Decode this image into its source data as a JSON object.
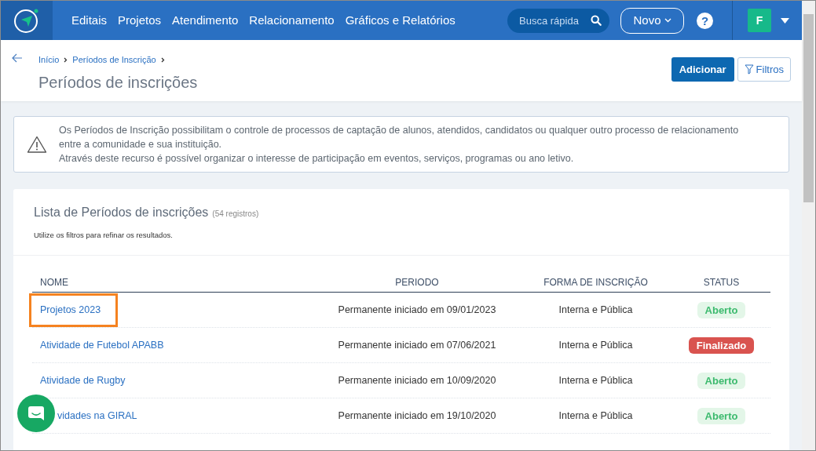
{
  "nav": {
    "items": [
      "Editais",
      "Projetos",
      "Atendimento",
      "Relacionamento",
      "Gráficos e Relatórios"
    ],
    "search": {
      "placeholder": "Busca rápida"
    },
    "new_button": "Novo",
    "help": "?",
    "avatar": "F"
  },
  "breadcrumb": [
    "Início",
    "Períodos de Inscrição"
  ],
  "page_title": "Períodos de inscrições",
  "actions": {
    "add": "Adicionar",
    "filters": "Filtros"
  },
  "alert": {
    "lines": [
      "Os Períodos de Inscrição possibilitam o controle de processos de captação de alunos, atendidos, candidatos ou qualquer outro processo de relacionamento entre a comunidade e sua instituição.",
      "Através deste recurso é possível organizar o interesse de participação em eventos, serviços, programas ou ano letivo."
    ]
  },
  "list": {
    "title": "Lista de Períodos de inscrições",
    "count": "(54 registros)",
    "hint": "Utilize os filtros para refinar os resultados.",
    "columns": [
      "NOME",
      "PERIODO",
      "FORMA DE INSCRIÇÃO",
      "STATUS"
    ],
    "rows": [
      {
        "name": "Projetos 2023",
        "period": "Permanente iniciado em 09/01/2023",
        "form": "Interna e Pública",
        "status": "Aberto",
        "kind": "open",
        "highlighted": true,
        "covered": false
      },
      {
        "name": "Atividade de Futebol APABB",
        "period": "Permanente iniciado em 07/06/2021",
        "form": "Interna e Pública",
        "status": "Finalizado",
        "kind": "closed",
        "highlighted": false,
        "covered": false
      },
      {
        "name": "Atividade de Rugby",
        "period": "Permanente iniciado em 10/09/2020",
        "form": "Interna e Pública",
        "status": "Aberto",
        "kind": "open",
        "highlighted": false,
        "covered": false
      },
      {
        "name": "vidades na GIRAL",
        "period": "Permanente iniciado em 19/10/2020",
        "form": "Interna e Pública",
        "status": "Aberto",
        "kind": "open",
        "highlighted": false,
        "covered": true
      }
    ]
  }
}
